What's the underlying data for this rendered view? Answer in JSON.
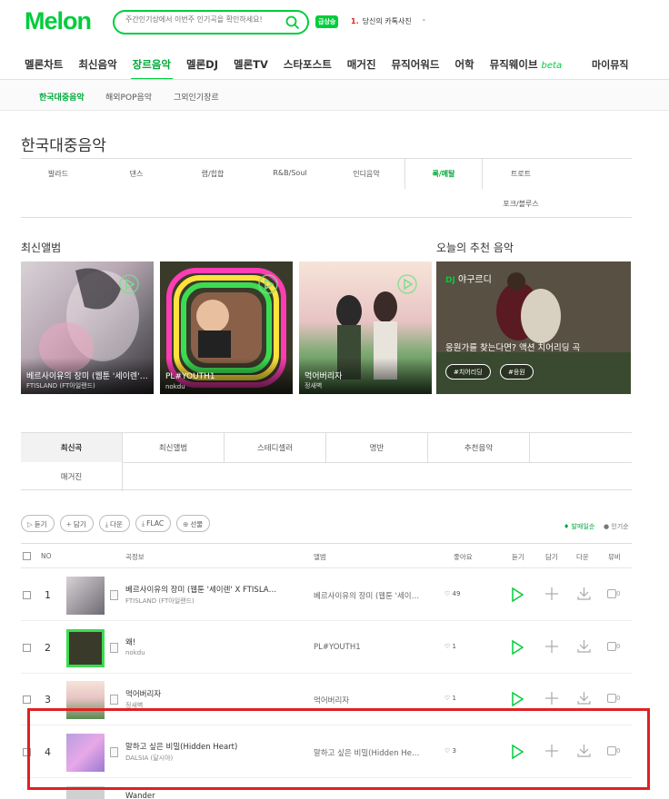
{
  "header": {
    "logo": "Melon",
    "search_placeholder": "주간인기상에서 이번주 인기곡을 확인하세요!",
    "rising_badge": "급상승",
    "rising_rank": "1.",
    "rising_text": "당신의 카톡사진"
  },
  "main_nav": [
    {
      "label": "멜론차트"
    },
    {
      "label": "최신음악"
    },
    {
      "label": "장르음악",
      "active": true
    },
    {
      "label": "멜론DJ"
    },
    {
      "label": "멜론TV"
    },
    {
      "label": "스타포스트"
    },
    {
      "label": "매거진"
    },
    {
      "label": "뮤직어워드"
    },
    {
      "label": "어학"
    },
    {
      "label": "뮤직웨이브",
      "beta": "beta"
    }
  ],
  "my_music": "마이뮤직",
  "sub_nav": [
    "한국대중음악",
    "해외POP음악",
    "그외인기장르"
  ],
  "page_title": "한국대중음악",
  "genres": [
    "발라드",
    "댄스",
    "랩/힙합",
    "R&B/Soul",
    "인디음악",
    "록/메탈",
    "트로트",
    "포크/블루스"
  ],
  "latest_album_label": "최신앨범",
  "recommend_label": "오늘의 추천 음악",
  "albums": [
    {
      "title": "베르사이유의 장미 (웹툰 '세이렌' X FTISLAND)",
      "artist": "FTISLAND (FT아일랜드)"
    },
    {
      "title": "PL#YOUTH1",
      "artist": "nokdu"
    },
    {
      "title": "먹어버리자",
      "artist": "정새벽"
    }
  ],
  "recommend": {
    "dj_prefix": "DJ",
    "dj_name": "야구르디",
    "text": "응원가를 찾는다면? 액션 치어리딩 곡",
    "tags": [
      "#치어리딩",
      "#응원"
    ]
  },
  "content_tabs": [
    "최신곡",
    "최신앨범",
    "스테디셀러",
    "명반",
    "추천음악",
    "매거진"
  ],
  "actions": [
    {
      "icon": "▷",
      "label": "듣기"
    },
    {
      "icon": "+",
      "label": "담기"
    },
    {
      "icon": "⤓",
      "label": "다운"
    },
    {
      "icon": "⤓",
      "label": "FLAC"
    },
    {
      "icon": "⊕",
      "label": "선물"
    }
  ],
  "sort": {
    "on": "♦ 발매일순",
    "off": "● 인기순"
  },
  "table_headers": {
    "no": "NO",
    "song": "곡정보",
    "album": "앨범",
    "like": "좋아요",
    "play": "듣기",
    "add": "담기",
    "download": "다운",
    "mv": "뮤비"
  },
  "songs": [
    {
      "rank": "1",
      "title": "베르사이유의 장미 (웹툰 '세이렌' X FTISLAND)",
      "artist": "FTISLAND (FT아일랜드)",
      "album": "베르사이유의 장미 (웹툰 '세이렌' X FTISLAND)",
      "likes": "49",
      "mv": "0"
    },
    {
      "rank": "2",
      "title": "왜!",
      "artist": "nokdu",
      "album": "PL#YOUTH1",
      "likes": "1",
      "mv": "0"
    },
    {
      "rank": "3",
      "title": "먹어버리자",
      "artist": "정새벽",
      "album": "먹어버리자",
      "likes": "1",
      "mv": "0"
    },
    {
      "rank": "4",
      "title": "말하고 싶은 비밀(Hidden Heart)",
      "artist": "DALSIA (달시아)",
      "album": "말하고 싶은 비밀(Hidden Heart)",
      "likes": "3",
      "mv": "0"
    },
    {
      "rank": "",
      "title": "Wander",
      "artist": "",
      "album": "",
      "likes": "",
      "mv": ""
    }
  ]
}
